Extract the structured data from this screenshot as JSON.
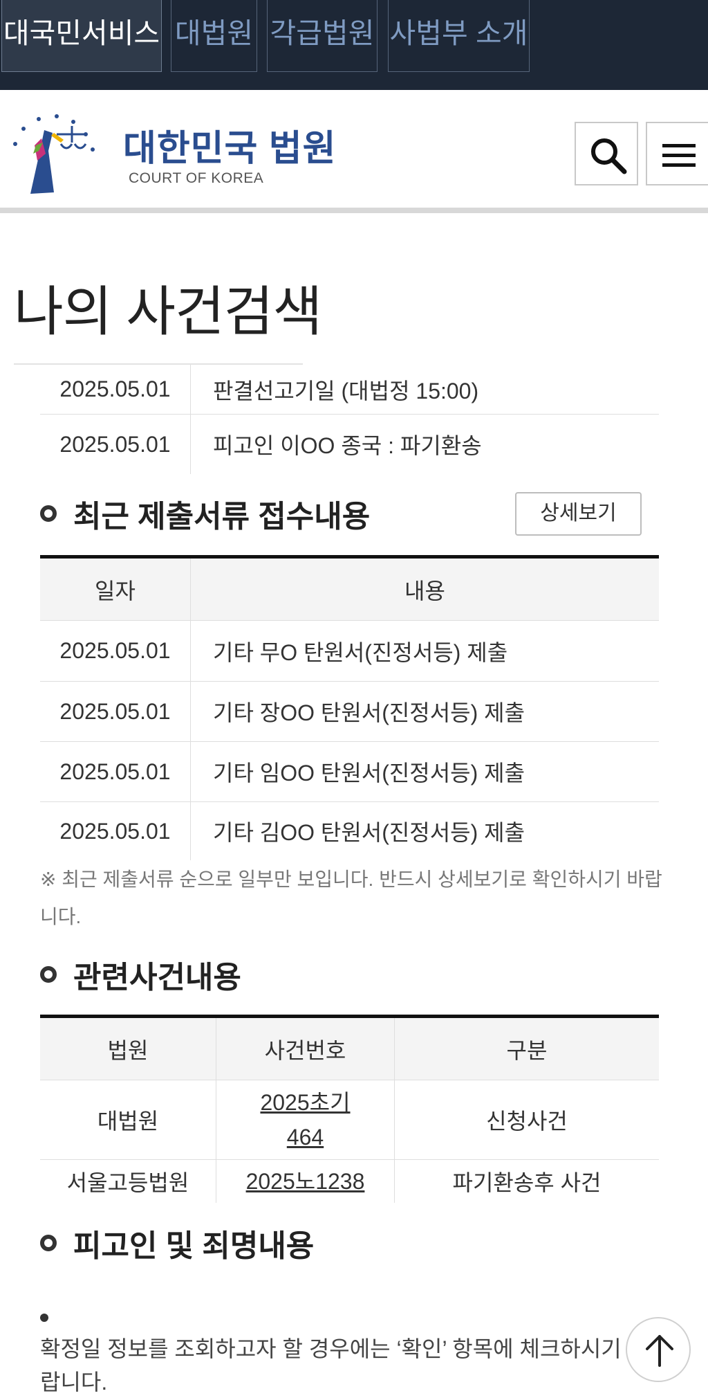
{
  "topnav": {
    "tabs": [
      {
        "label": "대국민서비스",
        "active": true
      },
      {
        "label": "대법원",
        "active": false
      },
      {
        "label": "각급법원",
        "active": false
      },
      {
        "label": "사법부 소개",
        "active": false
      }
    ]
  },
  "header": {
    "logo_title": "대한민국 법원",
    "logo_sub": "COURT OF KOREA",
    "logo_icon": "court-emblem-icon",
    "search_icon": "search-icon",
    "menu_icon": "hamburger-menu-icon"
  },
  "page": {
    "title": "나의 사건검색"
  },
  "schedule": {
    "rows": [
      {
        "date": "2025.05.01",
        "content": "판결선고기일 (대법정 15:00)"
      },
      {
        "date": "2025.05.01",
        "content": "피고인 이OO 종국 : 파기환송"
      }
    ]
  },
  "documents": {
    "heading": "최근 제출서류 접수내용",
    "detail_button": "상세보기",
    "columns": [
      "일자",
      "내용"
    ],
    "rows": [
      {
        "date": "2025.05.01",
        "content": "기타 무O 탄원서(진정서등) 제출"
      },
      {
        "date": "2025.05.01",
        "content": "기타 장OO 탄원서(진정서등) 제출"
      },
      {
        "date": "2025.05.01",
        "content": "기타 임OO 탄원서(진정서등) 제출"
      },
      {
        "date": "2025.05.01",
        "content": "기타 김OO 탄원서(진정서등) 제출"
      }
    ],
    "note": "※ 최근 제출서류 순으로 일부만 보입니다. 반드시 상세보기로 확인하시기 바랍니다."
  },
  "related": {
    "heading": "관련사건내용",
    "columns": [
      "법원",
      "사건번호",
      "구분"
    ],
    "rows": [
      {
        "court": "대법원",
        "case_line1": "2025초기",
        "case_line2": "464",
        "type": "신청사건"
      },
      {
        "court": "서울고등법원",
        "case_line1": "2025노1238",
        "case_line2": "",
        "type": "파기환송후 사건"
      }
    ]
  },
  "defendant": {
    "heading": "피고인 및 죄명내용",
    "info": "확정일 정보를 조회하고자 할 경우에는 ‘확인’ 항목에 체크하시기 바랍니다."
  },
  "scroll_top_icon": "arrow-up-icon"
}
